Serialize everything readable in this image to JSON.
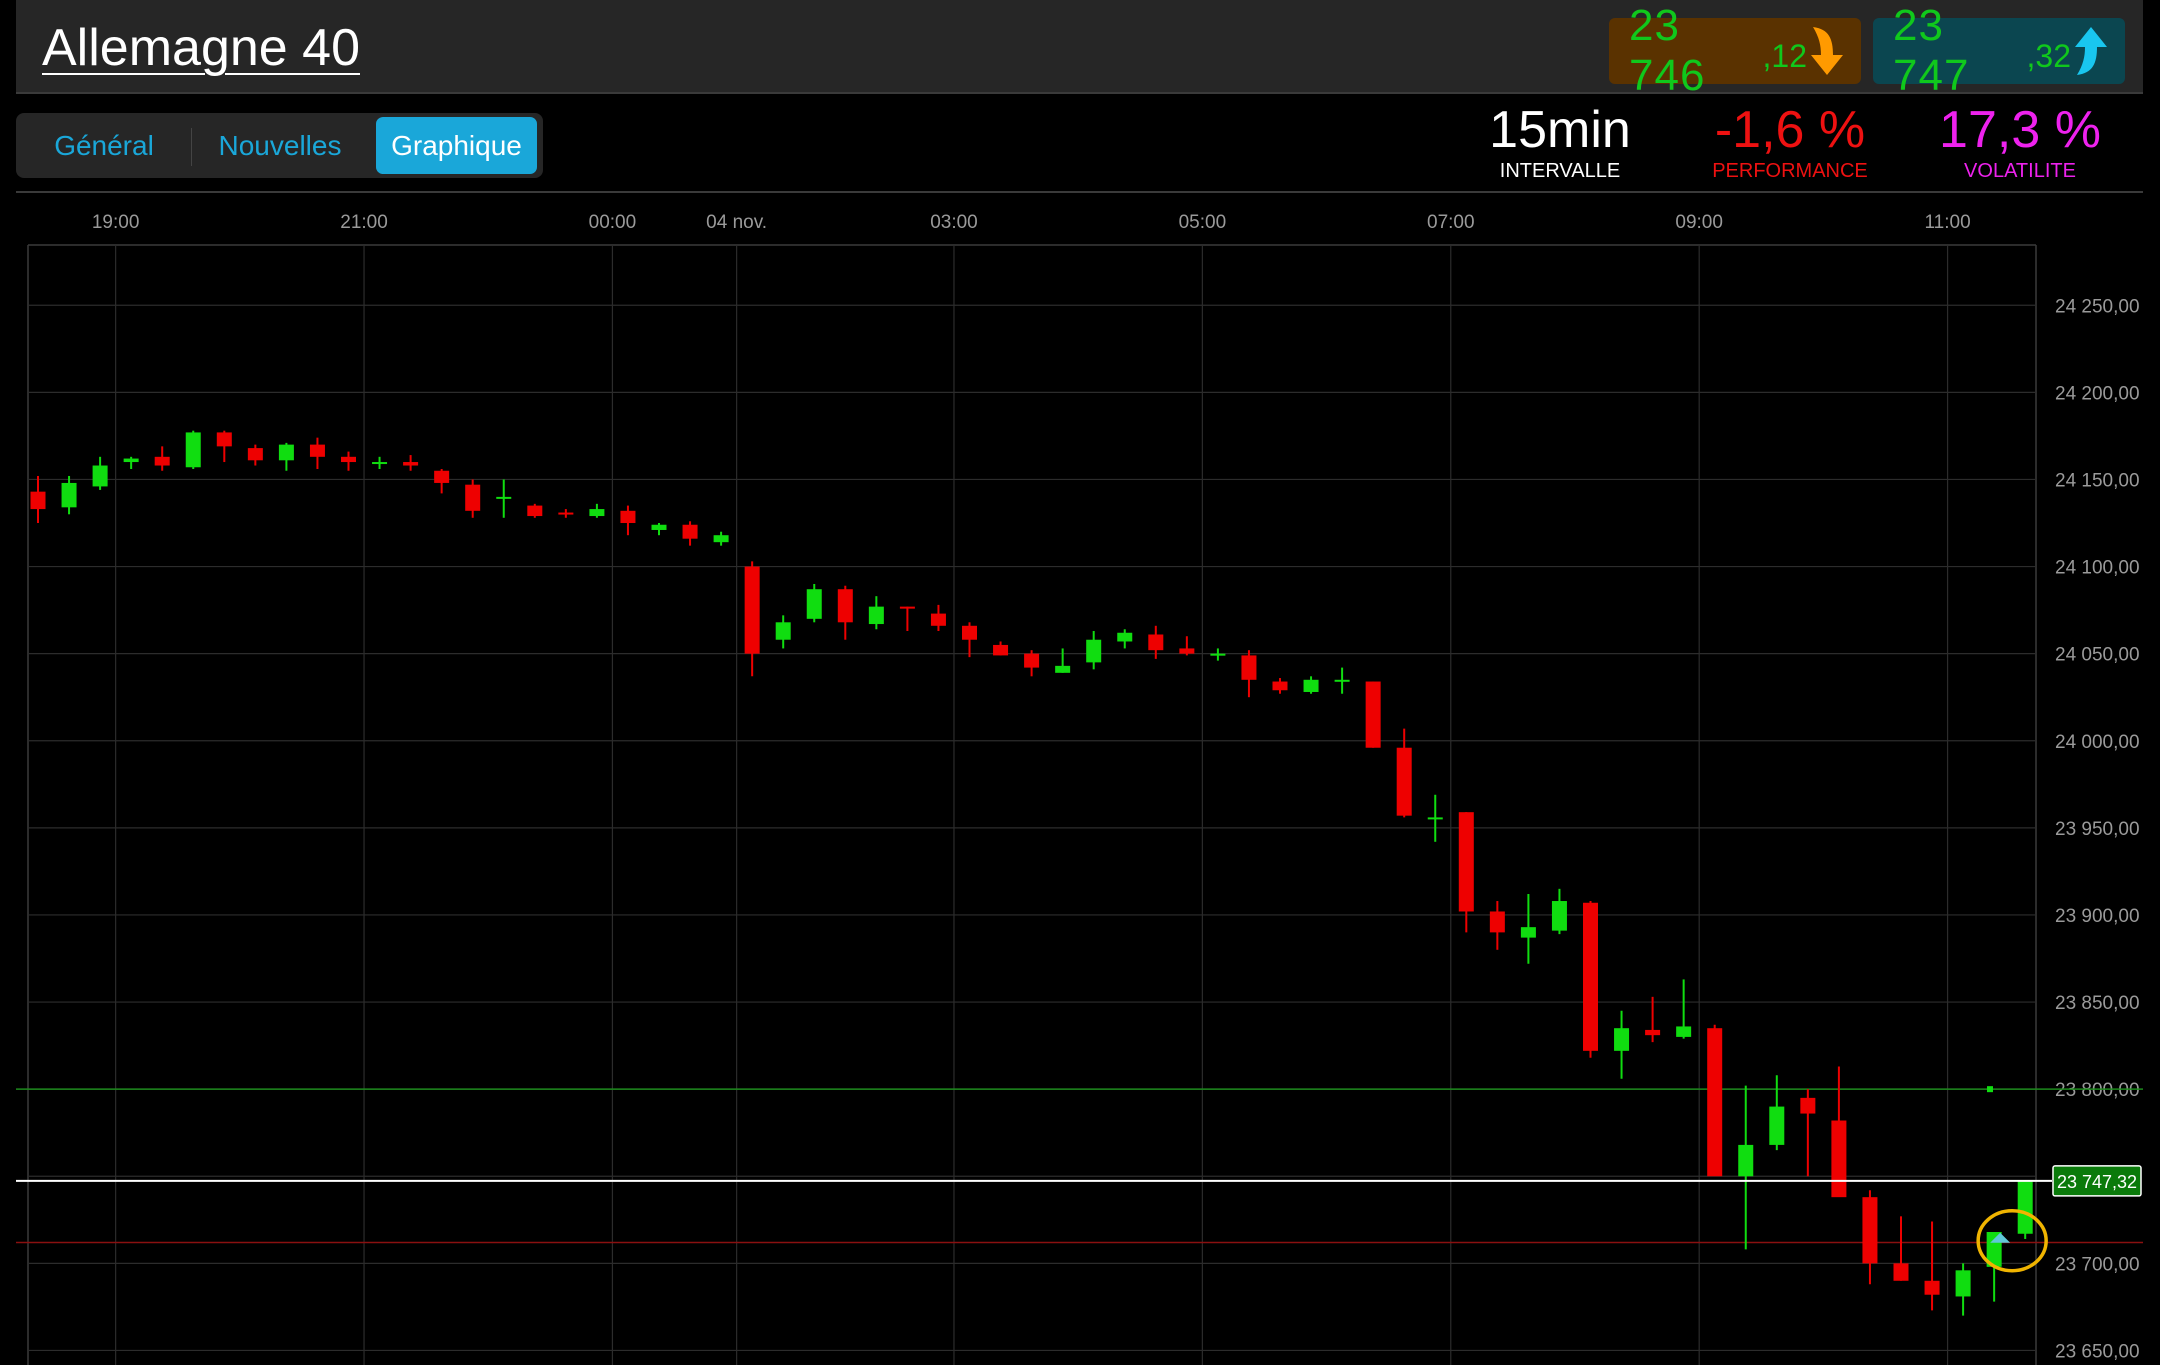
{
  "header": {
    "title": "Allemagne 40",
    "bid": {
      "main": "23 746",
      "decimals": ",12",
      "icon": "arrow-down-orange-icon"
    },
    "ask": {
      "main": "23 747",
      "decimals": ",32",
      "icon": "arrow-up-cyan-icon"
    }
  },
  "tabs": [
    {
      "label": "Général",
      "active": false
    },
    {
      "label": "Nouvelles",
      "active": false
    },
    {
      "label": "Graphique",
      "active": true
    }
  ],
  "stats": {
    "interval": {
      "value": "15min",
      "label": "INTERVALLE"
    },
    "performance": {
      "value": "-1,6 %",
      "label": "PERFORMANCE"
    },
    "volatility": {
      "value": "17,3 %",
      "label": "VOLATILITE"
    }
  },
  "colors": {
    "up": "#10dd10",
    "down": "#ee0000",
    "grid": "#2c2c2c",
    "performance": "#ee1111",
    "volatility": "#ee22ee",
    "bid_bg": "#5a3200",
    "ask_bg": "#0b4650",
    "accent": "#1aa7d9",
    "marker": "#f0b400"
  },
  "chart_data": {
    "type": "candlestick",
    "interval": "15min",
    "x_tick_labels": [
      {
        "label": "19:00",
        "index": 3
      },
      {
        "label": "21:00",
        "index": 11
      },
      {
        "label": "00:00",
        "index": 19
      },
      {
        "label": "04 nov.",
        "index": 23
      },
      {
        "label": "03:00",
        "index": 30
      },
      {
        "label": "05:00",
        "index": 38
      },
      {
        "label": "07:00",
        "index": 46
      },
      {
        "label": "09:00",
        "index": 54
      },
      {
        "label": "11:00",
        "index": 62
      }
    ],
    "y_ticks": [
      {
        "value": 23650,
        "label": "23 650,00"
      },
      {
        "value": 23700,
        "label": "23 700,00"
      },
      {
        "value": 23750,
        "label": "23 750,00"
      },
      {
        "value": 23800,
        "label": "23 800,00"
      },
      {
        "value": 23850,
        "label": "23 850,00"
      },
      {
        "value": 23900,
        "label": "23 900,00"
      },
      {
        "value": 23950,
        "label": "23 950,00"
      },
      {
        "value": 24000,
        "label": "24 000,00"
      },
      {
        "value": 24050,
        "label": "24 050,00"
      },
      {
        "value": 24100,
        "label": "24 100,00"
      },
      {
        "value": 24150,
        "label": "24 150,00"
      },
      {
        "value": 24200,
        "label": "24 200,00"
      },
      {
        "value": 24250,
        "label": "24 250,00"
      }
    ],
    "ylim": [
      23634,
      24280
    ],
    "current_price": {
      "value": 23747.32,
      "label": "23 747,32"
    },
    "green_level": 23800,
    "red_level": 23712,
    "candles": [
      [
        24143,
        24152,
        24125,
        24133
      ],
      [
        24134,
        24152,
        24130,
        24148
      ],
      [
        24146,
        24163,
        24144,
        24158
      ],
      [
        24160,
        24163,
        24156,
        24162
      ],
      [
        24163,
        24169,
        24155,
        24158
      ],
      [
        24157,
        24178,
        24156,
        24177
      ],
      [
        24177,
        24178,
        24160,
        24169
      ],
      [
        24168,
        24170,
        24158,
        24161
      ],
      [
        24161,
        24171,
        24155,
        24170
      ],
      [
        24170,
        24174,
        24156,
        24163
      ],
      [
        24163,
        24166,
        24155,
        24160
      ],
      [
        24159,
        24163,
        24156,
        24160
      ],
      [
        24160,
        24164,
        24155,
        24158
      ],
      [
        24155,
        24156,
        24142,
        24148
      ],
      [
        24147,
        24150,
        24128,
        24132
      ],
      [
        24140,
        24150,
        24128,
        24140
      ],
      [
        24135,
        24136,
        24128,
        24129
      ],
      [
        24131,
        24133,
        24128,
        24130
      ],
      [
        24129,
        24136,
        24128,
        24133
      ],
      [
        24132,
        24135,
        24118,
        24125
      ],
      [
        24121,
        24125,
        24118,
        24124
      ],
      [
        24124,
        24126,
        24112,
        24116
      ],
      [
        24114,
        24120,
        24112,
        24118
      ],
      [
        24100,
        24103,
        24037,
        24050
      ],
      [
        24058,
        24072,
        24053,
        24068
      ],
      [
        24070,
        24090,
        24068,
        24087
      ],
      [
        24087,
        24089,
        24058,
        24068
      ],
      [
        24067,
        24083,
        24064,
        24077
      ],
      [
        24077,
        24077,
        24063,
        24076
      ],
      [
        24073,
        24078,
        24063,
        24066
      ],
      [
        24066,
        24068,
        24048,
        24058
      ],
      [
        24055,
        24057,
        24049,
        24049
      ],
      [
        24050,
        24052,
        24037,
        24042
      ],
      [
        24039,
        24053,
        24039,
        24043
      ],
      [
        24045,
        24063,
        24041,
        24058
      ],
      [
        24057,
        24064,
        24053,
        24062
      ],
      [
        24061,
        24066,
        24047,
        24052
      ],
      [
        24053,
        24060,
        24049,
        24050
      ],
      [
        24050,
        24053,
        24046,
        24050
      ],
      [
        24049,
        24052,
        24025,
        24035
      ],
      [
        24034,
        24036,
        24027,
        24029
      ],
      [
        24028,
        24037,
        24027,
        24035
      ],
      [
        24035,
        24042,
        24027,
        24035
      ],
      [
        24034,
        24034,
        23996,
        23996
      ],
      [
        23996,
        24007,
        23956,
        23957
      ],
      [
        23956,
        23969,
        23942,
        23956
      ],
      [
        23959,
        23959,
        23890,
        23902
      ],
      [
        23902,
        23908,
        23880,
        23890
      ],
      [
        23887,
        23912,
        23872,
        23893
      ],
      [
        23891,
        23915,
        23889,
        23908
      ],
      [
        23907,
        23908,
        23818,
        23822
      ],
      [
        23822,
        23845,
        23806,
        23835
      ],
      [
        23834,
        23853,
        23827,
        23831
      ],
      [
        23830,
        23863,
        23829,
        23836
      ],
      [
        23835,
        23837,
        23761,
        23750
      ],
      [
        23750,
        23802,
        23708,
        23768
      ],
      [
        23768,
        23808,
        23765,
        23790
      ],
      [
        23795,
        23800,
        23750,
        23786
      ],
      [
        23782,
        23813,
        23740,
        23738
      ],
      [
        23738,
        23742,
        23688,
        23700
      ],
      [
        23700,
        23727,
        23690,
        23690
      ],
      [
        23690,
        23724,
        23673,
        23682
      ],
      [
        23681,
        23700,
        23670,
        23696
      ],
      [
        23698,
        23717,
        23678,
        23718
      ],
      [
        23717,
        23747,
        23714,
        23747
      ]
    ]
  }
}
